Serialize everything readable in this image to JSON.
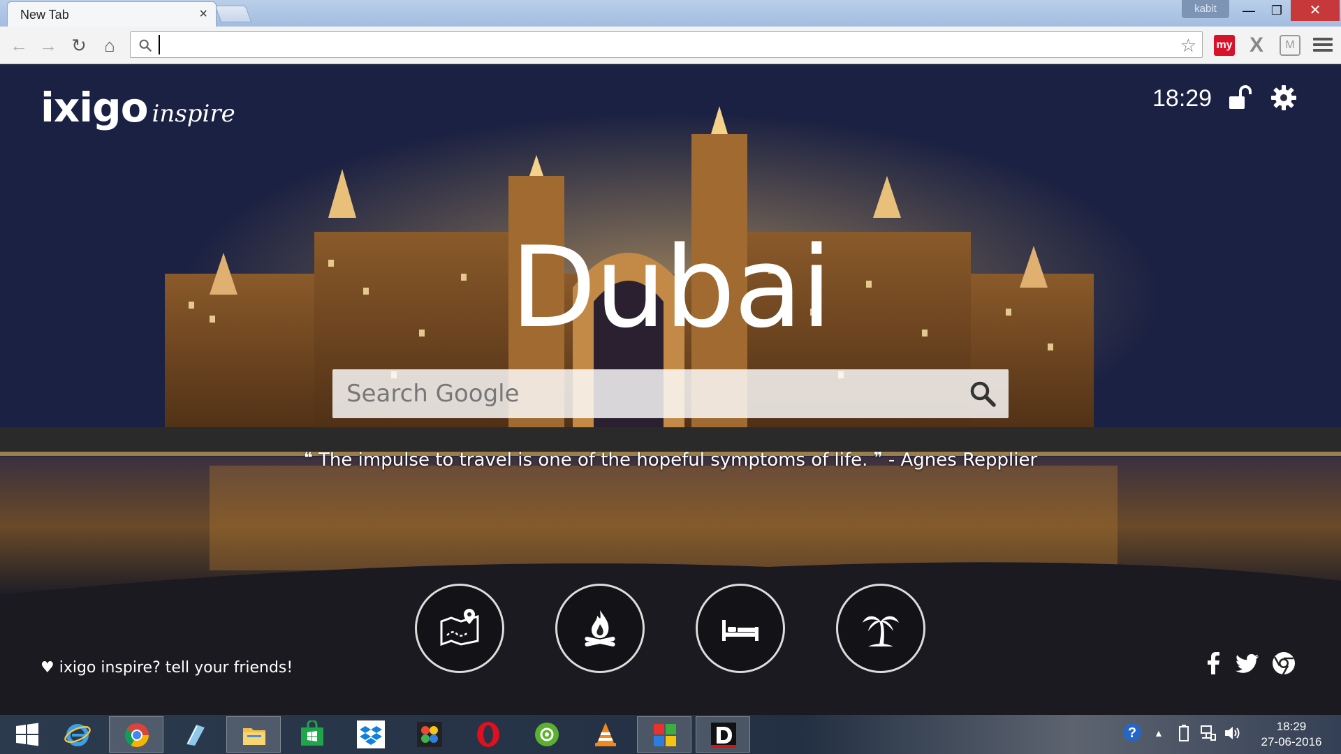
{
  "browser": {
    "tab_title": "New Tab",
    "tab_close": "×",
    "profile_name": "kabit",
    "window_minimize": "—",
    "window_restore": "❐",
    "window_close": "✕",
    "address_value": "",
    "ext_my_label": "my",
    "ext_x_label": "X",
    "ext_shield_label": "M"
  },
  "page": {
    "logo_main": "ixigo",
    "logo_sub": "inspire",
    "clock": "18:29",
    "city": "Dubai",
    "search_placeholder": "Search Google",
    "quote_open": "❝",
    "quote_text": "The impulse to travel is one of the hopeful symptoms of life.",
    "quote_close": "❞",
    "quote_author": "- Agnes Repplier",
    "share_text": "♥ ixigo inspire? tell your friends!",
    "category_buttons": [
      "map-icon",
      "campfire-icon",
      "bed-icon",
      "palm-tree-icon"
    ]
  },
  "taskbar": {
    "apps": [
      "windows-start-icon",
      "internet-explorer-icon",
      "chrome-icon",
      "notepad-icon",
      "file-explorer-icon",
      "windows-store-icon",
      "dropbox-icon",
      "paint-icon",
      "opera-icon",
      "media-icon",
      "vlc-icon",
      "tiles-app-icon",
      "d-app-icon"
    ],
    "time": "18:29",
    "date": "27-06-2016"
  }
}
